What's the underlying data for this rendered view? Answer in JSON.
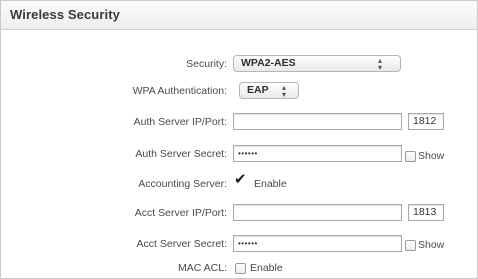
{
  "panel": {
    "title": "Wireless Security"
  },
  "form": {
    "security": {
      "label": "Security:",
      "value": "WPA2-AES"
    },
    "wpa_auth": {
      "label": "WPA Authentication:",
      "value": "EAP"
    },
    "auth_server": {
      "label": "Auth Server IP/Port:",
      "ip": "",
      "port": "1812"
    },
    "auth_secret": {
      "label": "Auth Server Secret:",
      "value": "••••••",
      "show_label": "Show",
      "show_checked": false
    },
    "accounting_server": {
      "label": "Accounting Server:",
      "enable_label": "Enable",
      "enabled": true
    },
    "acct_server": {
      "label": "Acct Server IP/Port:",
      "ip": "",
      "port": "1813"
    },
    "acct_secret": {
      "label": "Acct Server Secret:",
      "value": "••••••",
      "show_label": "Show",
      "show_checked": false
    },
    "mac_acl": {
      "label": "MAC ACL:",
      "enable_label": "Enable",
      "enabled": false
    }
  },
  "icons": {
    "select_arrows": "up-down-chevron-icon",
    "check": "checkmark-icon"
  }
}
